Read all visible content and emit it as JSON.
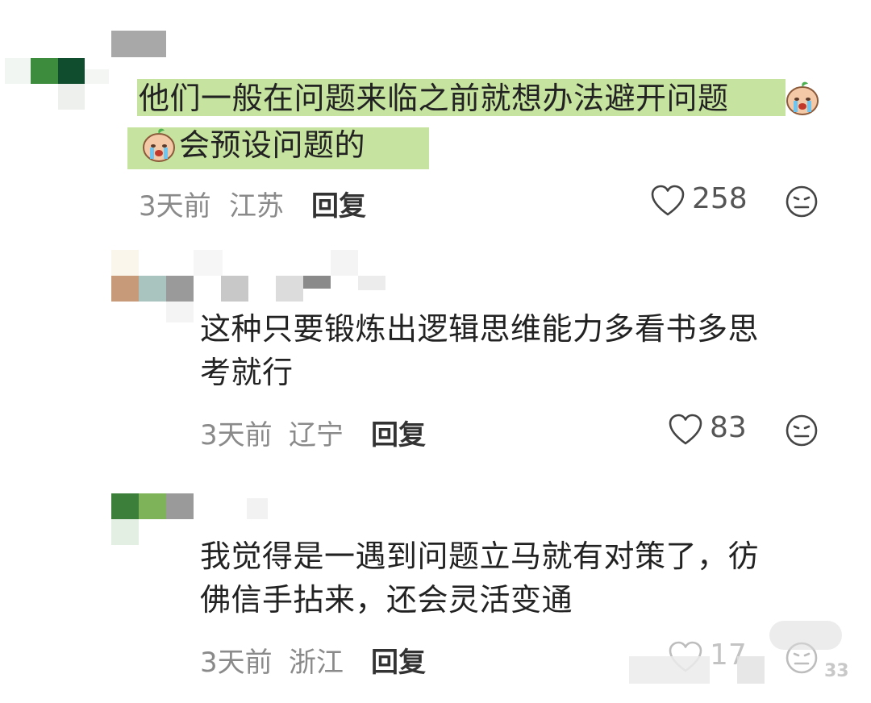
{
  "comments": [
    {
      "text_line1": "他们一般在问题来临之前就想办法避开问题",
      "text_line2": "会预设问题的",
      "time": "3天前",
      "location": "江苏",
      "reply_label": "回复",
      "likes": "258",
      "emoji_icon": "crying-sprout-emoji-icon",
      "highlight_color": "#b9dd8a"
    },
    {
      "text_line1": "这种只要锻炼出逻辑思维能力多看书多思",
      "text_line2": "考就行",
      "time": "3天前",
      "location": "辽宁",
      "reply_label": "回复",
      "likes": "83"
    },
    {
      "text_line1": "我觉得是一遇到问题立马就有对策了，彷",
      "text_line2": "佛信手拈来，还会灵活变通",
      "time": "3天前",
      "location": "浙江",
      "reply_label": "回复",
      "likes": "17"
    }
  ],
  "watermark": {
    "number": "33"
  },
  "colors": {
    "highlight": "#b9dd8a",
    "meta_text": "#8a8a8a",
    "body_text": "#222222"
  }
}
